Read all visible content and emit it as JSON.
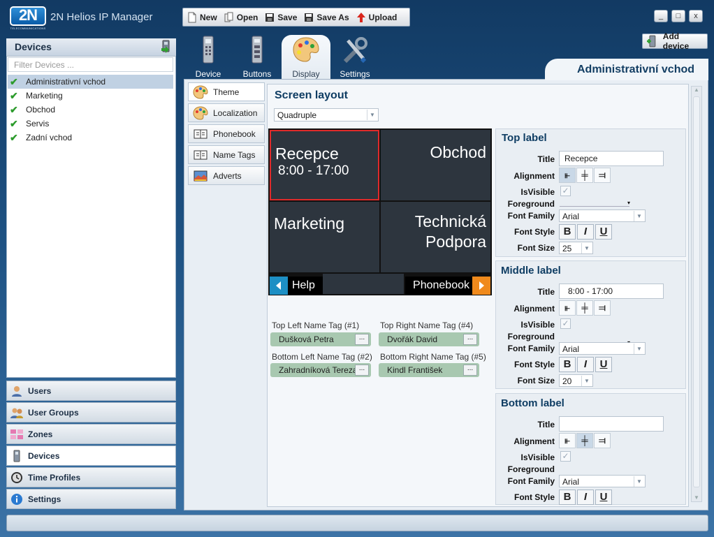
{
  "app": {
    "logo": "2N",
    "logo_sub": "TELECOMMUNICATIONS",
    "title": "2N Helios IP Manager"
  },
  "toolbar": {
    "new": "New",
    "open": "Open",
    "save": "Save",
    "save_as": "Save As",
    "upload": "Upload"
  },
  "window": {
    "minimize": "_",
    "maximize": "□",
    "close": "x"
  },
  "devices": {
    "header": "Devices",
    "filter_placeholder": "Filter Devices ...",
    "items": [
      "Administrativní vchod",
      "Marketing",
      "Obchod",
      "Servis",
      "Zadní vchod"
    ]
  },
  "nav": [
    "Users",
    "User Groups",
    "Zones",
    "Devices",
    "Time Profiles",
    "Settings"
  ],
  "tabs": [
    "Device",
    "Buttons",
    "Display",
    "Settings"
  ],
  "add_device": "Add device",
  "device_title": "Administrativní vchod",
  "subtabs": [
    "Theme",
    "Localization",
    "Phonebook",
    "Name Tags",
    "Adverts"
  ],
  "screen_layout": {
    "title": "Screen layout",
    "value": "Quadruple"
  },
  "preview": {
    "tl_title": "Recepce",
    "tl_sub": "8:00 - 17:00",
    "tr_title": "Obchod",
    "bl_title": "Marketing",
    "br_line1": "Technická",
    "br_line2": "Podpora",
    "help": "Help",
    "phonebook": "Phonebook"
  },
  "name_tags": [
    {
      "label": "Top Left Name Tag (#1)",
      "value": "Dušková Petra"
    },
    {
      "label": "Top Right Name Tag (#4)",
      "value": "Dvořák David"
    },
    {
      "label": "Bottom Left Name Tag (#2)",
      "value": "Zahradníková Tereza"
    },
    {
      "label": "Bottom Right Name Tag (#5)",
      "value": "Kindl František"
    }
  ],
  "more": "...",
  "labels": {
    "title": "Title",
    "alignment": "Alignment",
    "isvisible": "IsVisible",
    "foreground": "Foreground",
    "font_family": "Font Family",
    "font_style": "Font Style",
    "font_size": "Font Size",
    "bold": "B",
    "italic": "I",
    "underline": "U"
  },
  "top_label": {
    "header": "Top label",
    "title": "Recepce",
    "font_family": "Arial",
    "font_size": "25"
  },
  "middle_label": {
    "header": "Middle label",
    "title": "8:00 - 17:00",
    "font_family": "Arial",
    "font_size": "20"
  },
  "bottom_label": {
    "header": "Bottom label",
    "title": "",
    "font_family": "Arial"
  },
  "colors": {
    "accent": "#0f3d63",
    "selection": "#c0d1e3",
    "preview_bg": "#2d353e",
    "nav_help": "#1d8fc4",
    "nav_phonebook": "#f08a1c"
  }
}
